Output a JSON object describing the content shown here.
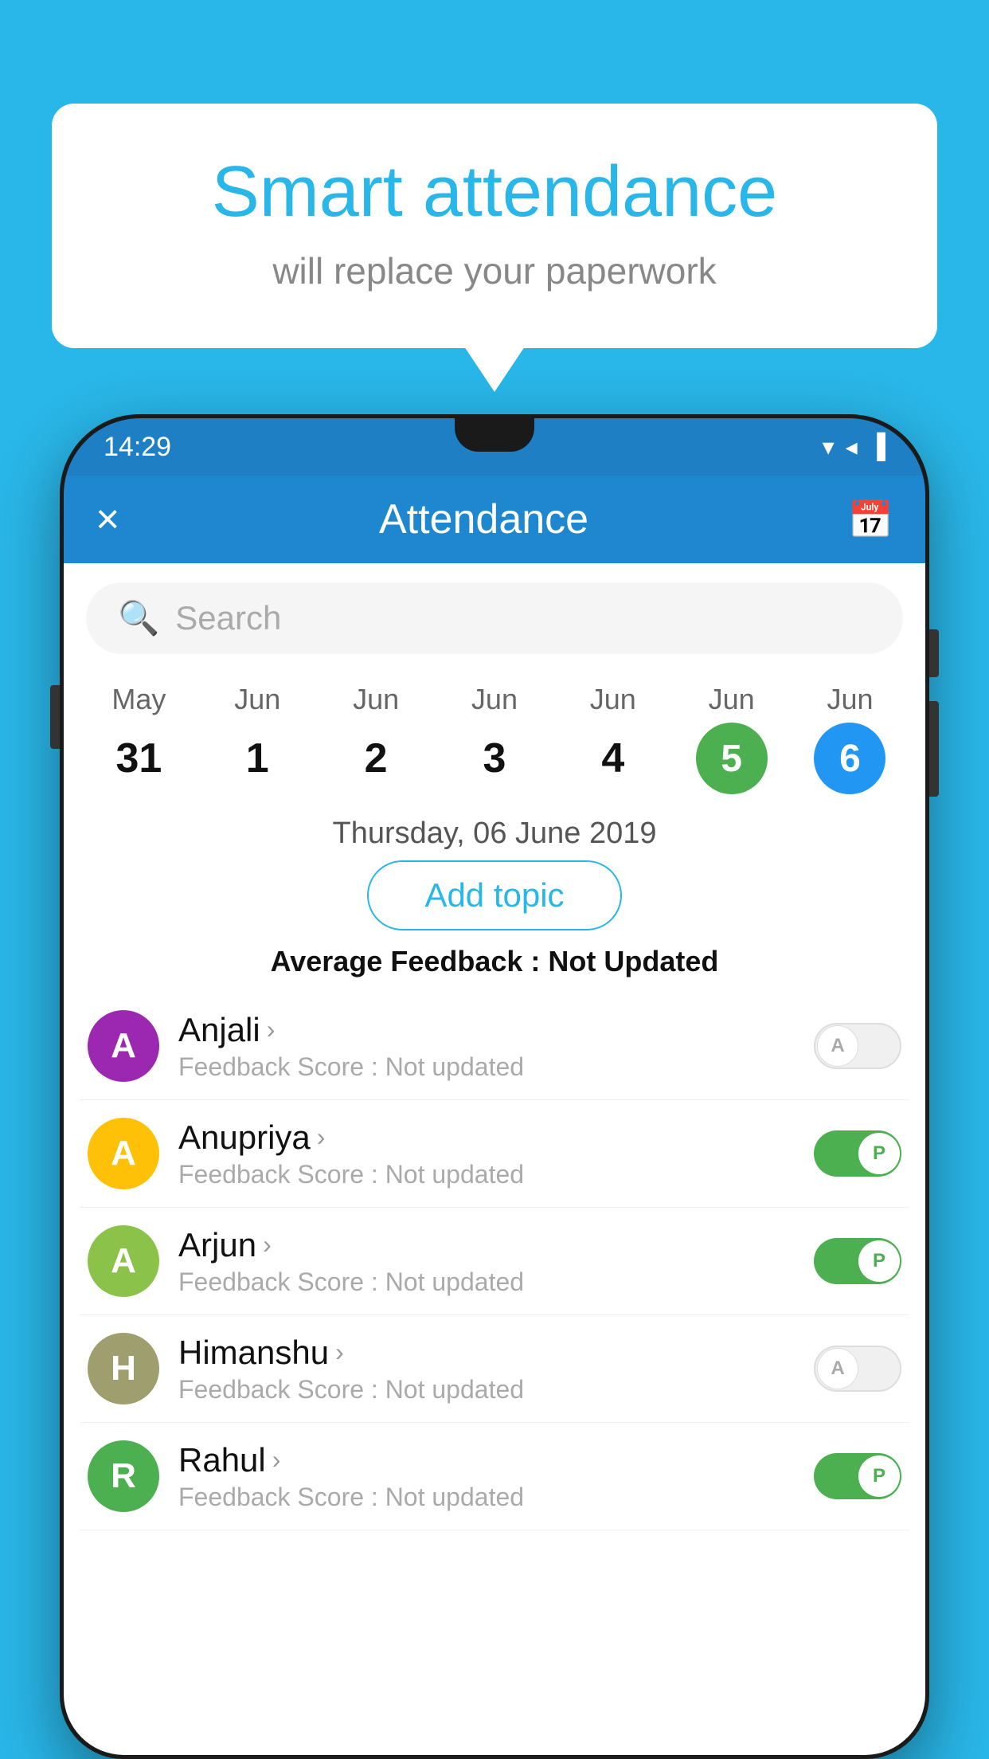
{
  "background_color": "#29b6e8",
  "bubble": {
    "title": "Smart attendance",
    "subtitle": "will replace your paperwork"
  },
  "status_bar": {
    "time": "14:29",
    "wifi": "▼",
    "signal": "▲",
    "battery": "▌"
  },
  "header": {
    "title": "Attendance",
    "close_label": "×",
    "calendar_icon": "📅"
  },
  "search": {
    "placeholder": "Search"
  },
  "calendar": {
    "days": [
      {
        "month": "May",
        "date": "31",
        "style": "normal"
      },
      {
        "month": "Jun",
        "date": "1",
        "style": "normal"
      },
      {
        "month": "Jun",
        "date": "2",
        "style": "normal"
      },
      {
        "month": "Jun",
        "date": "3",
        "style": "normal"
      },
      {
        "month": "Jun",
        "date": "4",
        "style": "normal"
      },
      {
        "month": "Jun",
        "date": "5",
        "style": "today"
      },
      {
        "month": "Jun",
        "date": "6",
        "style": "selected"
      }
    ]
  },
  "selected_date": "Thursday, 06 June 2019",
  "add_topic_label": "Add topic",
  "avg_feedback_label": "Average Feedback :",
  "avg_feedback_value": "Not Updated",
  "students": [
    {
      "name": "Anjali",
      "avatar_letter": "A",
      "avatar_color": "purple",
      "feedback": "Not updated",
      "toggle": "off",
      "toggle_label": "A"
    },
    {
      "name": "Anupriya",
      "avatar_letter": "A",
      "avatar_color": "yellow",
      "feedback": "Not updated",
      "toggle": "on",
      "toggle_label": "P"
    },
    {
      "name": "Arjun",
      "avatar_letter": "A",
      "avatar_color": "green",
      "feedback": "Not updated",
      "toggle": "on",
      "toggle_label": "P"
    },
    {
      "name": "Himanshu",
      "avatar_letter": "H",
      "avatar_color": "olive",
      "feedback": "Not updated",
      "toggle": "off",
      "toggle_label": "A"
    },
    {
      "name": "Rahul",
      "avatar_letter": "R",
      "avatar_color": "teal",
      "feedback": "Not updated",
      "toggle": "on",
      "toggle_label": "P"
    }
  ]
}
